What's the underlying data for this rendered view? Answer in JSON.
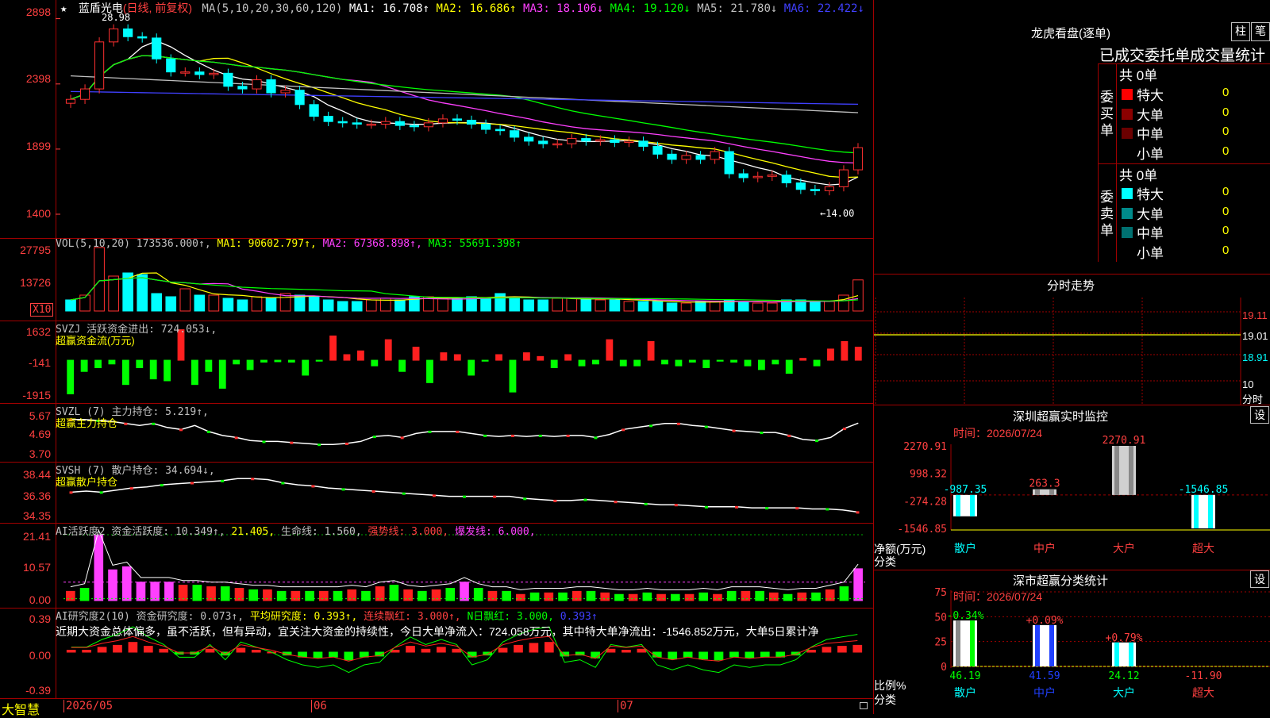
{
  "header": {
    "star": "★",
    "stock_name": "蓝盾光电",
    "period": "(日线, 前复权)",
    "ma_label": "MA(5,10,20,30,60,120)",
    "ma": [
      {
        "t": "MA1: 16.708↑",
        "c": "#ffffff"
      },
      {
        "t": "MA2: 16.686↑",
        "c": "#ffff00"
      },
      {
        "t": "MA3: 18.106↓",
        "c": "#ff40ff"
      },
      {
        "t": "MA4: 19.120↓",
        "c": "#00ff00"
      },
      {
        "t": "MA5: 21.780↓",
        "c": "#c0c0c0"
      },
      {
        "t": "MA6: 22.422↓",
        "c": "#4040ff"
      }
    ]
  },
  "price_axis": [
    "2898",
    "2398",
    "1899",
    "1400"
  ],
  "price_marks": {
    "high": "28.98",
    "low": "←14.00"
  },
  "vol": {
    "title": "VOL(5,10,20) 173536.000↑,",
    "ma1": "MA1: 90602.797↑,",
    "ma2": "MA2: 67368.898↑,",
    "ma3": "MA3: 55691.398↑",
    "axis": [
      "27795",
      "13726"
    ],
    "x10": "X10"
  },
  "svzj": {
    "title": "SVZJ  活跃资金进出: 724.053↓,",
    "sub": "超赢资金流(万元)",
    "axis": [
      "1632",
      "-141",
      "-1915"
    ]
  },
  "svzl": {
    "title": "SVZL (7) 主力持仓: 5.219↑,",
    "sub": "超赢主力持仓",
    "axis": [
      "5.67",
      "4.69",
      "3.70"
    ]
  },
  "svsh": {
    "title": "SVSH (7) 散户持仓: 34.694↓,",
    "sub": "超赢散户持仓",
    "axis": [
      "38.44",
      "36.36",
      "34.35"
    ]
  },
  "ai1": {
    "title": "AI活跃度2 资金活跃度: 10.349↑,",
    "v2": "21.405,",
    "v3": "生命线: 1.560,",
    "v4": "强势线: 3.000,",
    "v5": "爆发线: 6.000,",
    "axis": [
      "21.41",
      "10.57",
      "0.00"
    ]
  },
  "ai2": {
    "title": "AI研究度2(10) 资金研究度: 0.073↑,",
    "v2": "平均研究度: 0.393↑,",
    "v3": "连续飘红: 3.000↑,",
    "v4": "N日飘红: 3.000,",
    "v5": "0.393↑",
    "text": "近期大资金总体偏多，虽不活跃，但有异动，宜关注大资金的持续性，今日大单净流入：724.058万元，其中特大单净流出：-1546.852万元，大单5日累计净",
    "axis": [
      "0.39",
      "0.00",
      "-0.39"
    ]
  },
  "bottom": {
    "app": "大智慧",
    "dates": [
      "2026/05",
      "06",
      "07"
    ]
  },
  "dragon": {
    "title": "龙虎看盘(逐单)",
    "btn1": "柱",
    "btn2": "笔",
    "header": "已成交委托单成交量统计",
    "buy_label": "委买单",
    "sell_label": "委卖单",
    "buy_total": "共 0单",
    "sell_total": "共 0单",
    "buy_rows": [
      {
        "l": "特大",
        "v": "0",
        "c": "#ff0000"
      },
      {
        "l": "大单",
        "v": "0",
        "c": "#8b0000"
      },
      {
        "l": "中单",
        "v": "0",
        "c": "#6b0000"
      },
      {
        "l": "小单",
        "v": "0",
        "c": ""
      }
    ],
    "sell_rows": [
      {
        "l": "特大",
        "v": "0",
        "c": "#00ffff"
      },
      {
        "l": "大单",
        "v": "0",
        "c": "#008b8b"
      },
      {
        "l": "中单",
        "v": "0",
        "c": "#007070"
      },
      {
        "l": "小单",
        "v": "0",
        "c": ""
      }
    ]
  },
  "fenshi": {
    "title": "分时走势",
    "axis": [
      "19.11",
      "19.01",
      "18.91",
      "10"
    ],
    "unit": "分时"
  },
  "monitor": {
    "title": "深圳超赢实时监控",
    "btn": "设",
    "time": "时间：2026/07/24",
    "axis": [
      "2270.91",
      "998.32",
      "-274.28",
      "-1546.85"
    ],
    "ylab": "净额(万元)",
    "xlab": "分类",
    "bars": [
      {
        "cat": "散户",
        "val": -987.35,
        "lab": "-987.35"
      },
      {
        "cat": "中户",
        "val": 263.3,
        "lab": "263.3"
      },
      {
        "cat": "大户",
        "val": 2270.91,
        "lab": "2270.91"
      },
      {
        "cat": "超大",
        "val": -1546.85,
        "lab": "-1546.85"
      }
    ]
  },
  "classify": {
    "title": "深市超赢分类统计",
    "btn": "设",
    "time": "时间：2026/07/24",
    "axis": [
      "75",
      "50",
      "25",
      "0"
    ],
    "ylab": "比例%",
    "xlab": "分类",
    "bars": [
      {
        "cat": "散户",
        "val": 46.19,
        "pct": "-0.34%"
      },
      {
        "cat": "中户",
        "val": 41.59,
        "pct": "+0.09%"
      },
      {
        "cat": "大户",
        "val": 24.12,
        "pct": "+0.79%"
      },
      {
        "cat": "超大",
        "val": -11.9,
        "pct": ""
      }
    ],
    "vals": [
      "46.19",
      "41.59",
      "24.12",
      "-11.90"
    ]
  },
  "chart_data": [
    {
      "type": "candlestick",
      "title": "蓝盾光电 (日线, 前复权)",
      "ylim": [
        14.0,
        29.5
      ],
      "y_ticks": [
        28.98,
        23.98,
        18.99,
        14.0
      ],
      "x_ticks": [
        "2026/05",
        "06",
        "07"
      ],
      "high": 28.98,
      "low": 14.0,
      "close": [
        22.8,
        23.6,
        27.2,
        28.2,
        27.6,
        27.5,
        25.9,
        24.9,
        24.9,
        24.7,
        24.8,
        23.8,
        23.6,
        24.3,
        23.3,
        23.5,
        22.4,
        21.5,
        21.1,
        21.0,
        20.9,
        20.9,
        21.1,
        20.8,
        20.7,
        21.0,
        21.3,
        21.2,
        20.9,
        20.5,
        20.4,
        19.9,
        19.6,
        19.4,
        19.4,
        19.8,
        19.6,
        19.7,
        19.5,
        19.6,
        19.2,
        18.6,
        18.2,
        18.5,
        18.2,
        18.8,
        17.1,
        16.8,
        16.9,
        17.0,
        16.4,
        15.9,
        15.8,
        16.1,
        17.4,
        19.1
      ],
      "ma_current": {
        "MA1": 16.708,
        "MA2": 16.686,
        "MA3": 18.106,
        "MA4": 19.12,
        "MA5": 21.78,
        "MA6": 22.422
      }
    },
    {
      "type": "bar",
      "title": "VOL(5,10,20)",
      "latest": 173536.0,
      "ma": {
        "MA1": 90602.797,
        "MA2": 67368.898,
        "MA3": 55691.398
      },
      "values": [
        3.5,
        5.0,
        20.0,
        11.0,
        12.0,
        11.5,
        5.5,
        4.5,
        7.0,
        5.0,
        5.0,
        4.0,
        3.5,
        4.5,
        4.0,
        5.5,
        5.0,
        4.5,
        3.5,
        3.0,
        3.0,
        3.5,
        4.0,
        3.5,
        4.5,
        4.5,
        4.0,
        4.0,
        4.5,
        4.0,
        5.5,
        4.5,
        3.5,
        3.5,
        4.0,
        4.0,
        4.0,
        3.5,
        3.5,
        3.0,
        3.0,
        3.0,
        2.5,
        2.5,
        3.0,
        3.0,
        3.5,
        3.0,
        2.5,
        2.5,
        3.5,
        3.5,
        3.0,
        3.0,
        5.0,
        9.8
      ]
    },
    {
      "type": "bar",
      "title": "SVZJ 活跃资金进出",
      "latest": 724.053,
      "y_ticks": [
        1632,
        -141,
        -1915
      ],
      "values": [
        -1800,
        -600,
        -400,
        -200,
        -1300,
        -400,
        -1000,
        -1100,
        1632,
        -1300,
        -600,
        -1500,
        -200,
        -500,
        -100,
        -80,
        -100,
        -800,
        -50,
        1300,
        300,
        500,
        -300,
        1100,
        -600,
        700,
        -1200,
        400,
        300,
        -800,
        -50,
        300,
        -1700,
        400,
        200,
        -400,
        300,
        -300,
        -200,
        1100,
        -300,
        -300,
        1000,
        -200,
        -300,
        -100,
        -400,
        -50,
        -100,
        -300,
        -500,
        -200,
        -700,
        100,
        -300,
        600,
        1000,
        700
      ]
    },
    {
      "type": "line",
      "title": "SVZL (7) 主力持仓",
      "latest": 5.219,
      "y_ticks": [
        5.67,
        4.69,
        3.7
      ],
      "values": [
        5.4,
        5.4,
        5.35,
        5.3,
        5.2,
        5.1,
        5.2,
        5.0,
        4.9,
        5.1,
        4.8,
        4.6,
        4.5,
        4.35,
        4.3,
        4.3,
        4.25,
        4.2,
        4.15,
        4.15,
        4.2,
        4.3,
        4.55,
        4.6,
        4.5,
        4.7,
        4.8,
        4.8,
        4.8,
        4.7,
        4.6,
        4.55,
        4.6,
        4.55,
        4.6,
        4.55,
        4.6,
        4.6,
        4.5,
        4.65,
        4.9,
        5.0,
        5.1,
        5.2,
        5.2,
        5.1,
        5.05,
        4.95,
        4.85,
        4.8,
        4.75,
        4.75,
        4.6,
        4.4,
        4.35,
        4.5,
        4.95,
        5.22
      ]
    },
    {
      "type": "line",
      "title": "SVSH (7) 散户持仓",
      "latest": 34.694,
      "y_ticks": [
        38.44,
        36.36,
        34.35
      ],
      "values": [
        36.6,
        36.7,
        36.6,
        36.8,
        37.0,
        37.1,
        37.3,
        37.4,
        37.5,
        37.6,
        37.7,
        37.9,
        37.9,
        37.8,
        37.5,
        37.3,
        37.2,
        37.0,
        36.9,
        36.8,
        36.7,
        36.6,
        36.5,
        36.4,
        36.3,
        36.2,
        36.2,
        36.2,
        36.2,
        36.2,
        36.0,
        35.9,
        35.8,
        35.8,
        35.9,
        35.8,
        35.7,
        35.6,
        35.5,
        35.4,
        35.4,
        35.3,
        35.2,
        35.2,
        35.2,
        35.1,
        35.1,
        35.1,
        35.1,
        35.0,
        35.0,
        34.9,
        34.7
      ]
    },
    {
      "type": "bar",
      "title": "AI活跃度2 资金活跃度",
      "latest": 10.349,
      "lines": {
        "生命线": 1.56,
        "强势线": 3.0,
        "爆发线": 6.0
      },
      "y_ticks": [
        21.41,
        10.57,
        0.0
      ],
      "values": [
        3.0,
        4.0,
        21.4,
        10.0,
        11.0,
        6.0,
        6.0,
        6.0,
        5.0,
        5.0,
        4.5,
        4.5,
        4.0,
        3.5,
        3.5,
        3.0,
        3.0,
        3.0,
        3.0,
        3.0,
        3.5,
        3.0,
        4.5,
        5.0,
        3.5,
        3.0,
        3.5,
        4.0,
        6.0,
        4.0,
        3.0,
        3.0,
        2.0,
        2.5,
        2.5,
        2.5,
        3.0,
        3.0,
        2.5,
        2.0,
        2.0,
        2.5,
        2.0,
        2.0,
        2.0,
        2.5,
        2.0,
        3.0,
        3.0,
        3.0,
        2.5,
        2.0,
        2.5,
        2.5,
        3.5,
        4.5,
        10.35
      ]
    },
    {
      "type": "bar",
      "title": "AI研究度2(10) 资金研究度",
      "latest": 0.073,
      "avg": 0.393,
      "y_ticks": [
        0.39,
        0.0,
        -0.39
      ],
      "values": [
        0.02,
        0.02,
        0.05,
        0.07,
        0.1,
        0.06,
        0.03,
        -0.02,
        -0.02,
        0.03,
        -0.03,
        0.04,
        0.02,
        0.0,
        -0.03,
        -0.05,
        -0.06,
        -0.05,
        -0.08,
        -0.05,
        -0.04,
        0.02,
        0.06,
        0.03,
        0.05,
        0.03,
        -0.05,
        -0.03,
        0.04,
        0.07,
        0.09,
        0.1,
        -0.04,
        -0.03,
        -0.06,
        0.03,
        0.02,
        0.03,
        -0.05,
        -0.07,
        -0.05,
        -0.07,
        -0.08,
        -0.05,
        -0.06,
        -0.05,
        -0.05,
        -0.03,
        0.02,
        0.05,
        0.06,
        0.07
      ]
    },
    {
      "type": "bar",
      "title": "深圳超赢实时监控",
      "ylabel": "净额(万元)",
      "xlabel": "分类",
      "categories": [
        "散户",
        "中户",
        "大户",
        "超大"
      ],
      "values": [
        -987.35,
        263.3,
        2270.91,
        -1546.85
      ],
      "y_ticks": [
        2270.91,
        998.32,
        -274.28,
        -1546.85
      ]
    },
    {
      "type": "bar",
      "title": "深市超赢分类统计",
      "ylabel": "比例%",
      "xlabel": "分类",
      "categories": [
        "散户",
        "中户",
        "大户",
        "超大"
      ],
      "values": [
        46.19,
        41.59,
        24.12,
        -11.9
      ],
      "changes": [
        "-0.34%",
        "+0.09%",
        "+0.79%",
        ""
      ],
      "ylim": [
        0,
        75
      ]
    }
  ]
}
